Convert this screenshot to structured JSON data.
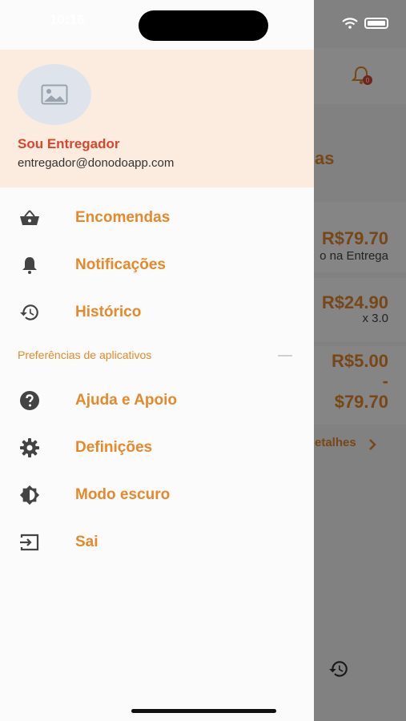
{
  "status_bar": {
    "time": "10:16"
  },
  "background": {
    "title_fragment": "as",
    "price_1": "R$79.70",
    "sub_1": "o na Entrega",
    "price_2": "R$24.90",
    "sub_2": "x 3.0",
    "price_3": "R$5.00",
    "dash": "-",
    "price_4": "$79.70",
    "details": "etalhes",
    "notification_badge": "0"
  },
  "drawer": {
    "user_name": "Sou Entregador",
    "user_email": "entregador@donodoapp.com",
    "menu": [
      {
        "label": "Encomendas",
        "icon": "basket-icon"
      },
      {
        "label": "Notificações",
        "icon": "bell-icon"
      },
      {
        "label": "Histórico",
        "icon": "history-icon"
      }
    ],
    "section_title": "Preferências de aplicativos",
    "prefs": [
      {
        "label": "Ajuda e Apoio",
        "icon": "help-icon"
      },
      {
        "label": "Definições",
        "icon": "gear-icon"
      },
      {
        "label": "Modo escuro",
        "icon": "brightness-icon"
      },
      {
        "label": "Sai",
        "icon": "logout-icon"
      }
    ]
  },
  "colors": {
    "accent": "#e5892a",
    "name": "#d9462e",
    "header_bg": "#fcece0",
    "icon": "#444444"
  }
}
